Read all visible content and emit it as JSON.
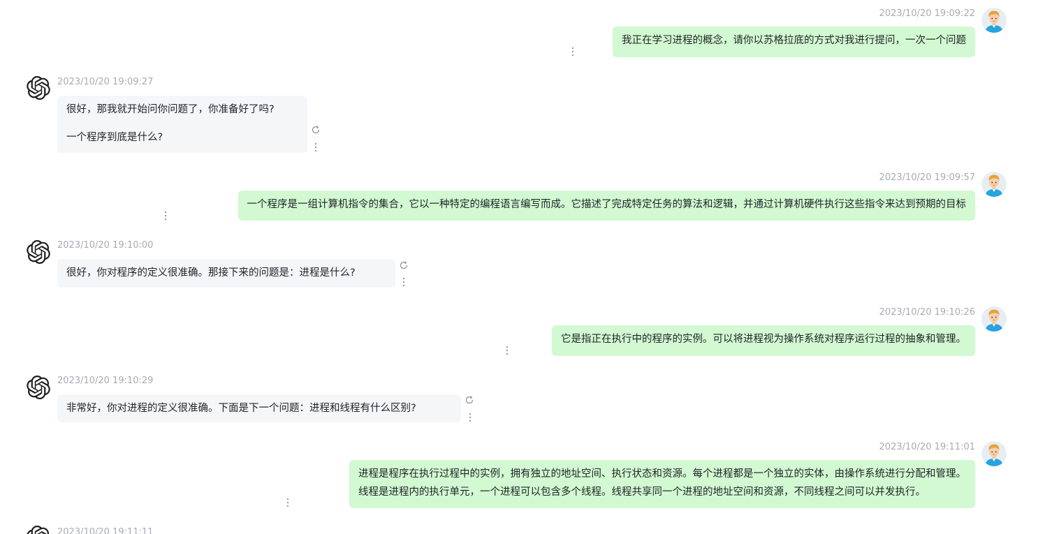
{
  "chat": {
    "messages": [
      {
        "role": "user",
        "timestamp": "2023/10/20 19:09:22",
        "text": "我正在学习进程的概念，请你以苏格拉底的方式对我进行提问，一次一个问题"
      },
      {
        "role": "assistant",
        "timestamp": "2023/10/20 19:09:27",
        "line1": "很好，那我就开始问你问题了，你准备好了吗?",
        "line2": "一个程序到底是什么?"
      },
      {
        "role": "user",
        "timestamp": "2023/10/20 19:09:57",
        "text": "一个程序是一组计算机指令的集合，它以一种特定的编程语言编写而成。它描述了完成特定任务的算法和逻辑，并通过计算机硬件执行这些指令来达到预期的目标"
      },
      {
        "role": "assistant",
        "timestamp": "2023/10/20 19:10:00",
        "text": "很好，你对程序的定义很准确。那接下来的问题是：进程是什么?"
      },
      {
        "role": "user",
        "timestamp": "2023/10/20 19:10:26",
        "text": "它是指正在执行中的程序的实例。可以将进程视为操作系统对程序运行过程的抽象和管理。"
      },
      {
        "role": "assistant",
        "timestamp": "2023/10/20 19:10:29",
        "text": "非常好，你对进程的定义很准确。下面是下一个问题：进程和线程有什么区别?"
      },
      {
        "role": "user",
        "timestamp": "2023/10/20 19:11:01",
        "line1": "进程是程序在执行过程中的实例，拥有独立的地址空间、执行状态和资源。每个进程都是一个独立的实体，由操作系统进行分配和管理。",
        "line2": "线程是进程内的执行单元，一个进程可以包含多个线程。线程共享同一个进程的地址空间和资源，不同线程之间可以并发执行。"
      },
      {
        "role": "assistant",
        "timestamp": "2023/10/20 19:11:11"
      }
    ]
  },
  "icons": {
    "assistant_avatar": "openai-logo-icon",
    "user_avatar": "cartoon-user-avatar",
    "more": "more-vertical-icon",
    "regenerate": "refresh-icon"
  },
  "colors": {
    "user_bubble": "#d2f9d1",
    "assistant_bubble": "#f4f6f8",
    "timestamp": "#a8abb2",
    "text": "#1f2329"
  }
}
